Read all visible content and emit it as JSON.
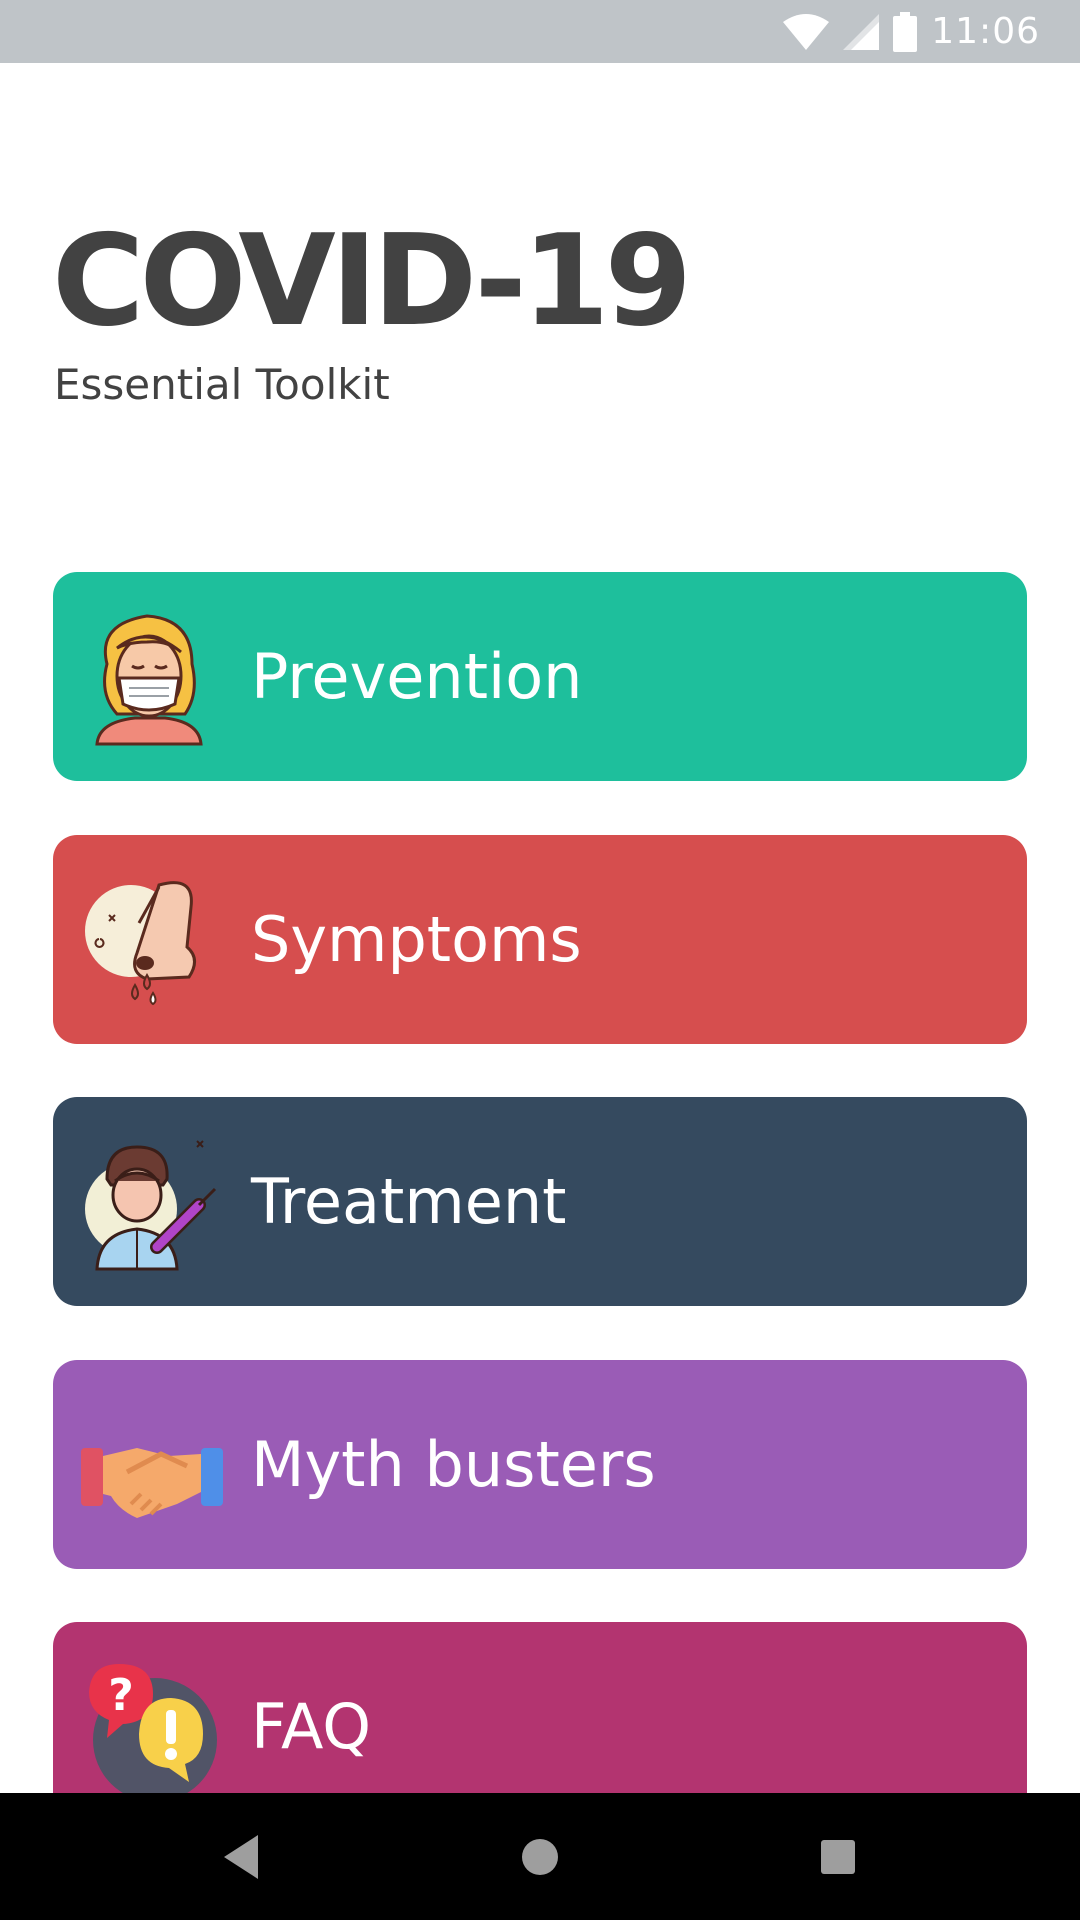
{
  "status_bar": {
    "time": "11:06",
    "icons": [
      "wifi-icon",
      "cell-signal-icon",
      "battery-icon"
    ]
  },
  "header": {
    "title": "COVID-19",
    "subtitle": "Essential Toolkit"
  },
  "menu": {
    "items": [
      {
        "label": "Prevention",
        "color": "#1ebf9c",
        "icon": "masked-woman-icon"
      },
      {
        "label": "Symptoms",
        "color": "#d64e4e",
        "icon": "runny-nose-icon"
      },
      {
        "label": "Treatment",
        "color": "#354a5f",
        "icon": "doctor-syringe-icon"
      },
      {
        "label": "Myth busters",
        "color": "#9a5cb6",
        "icon": "handshake-icon"
      },
      {
        "label": "FAQ",
        "color": "#b33470",
        "icon": "question-exclamation-icon"
      }
    ]
  },
  "nav_bar": {
    "buttons": [
      "back-icon",
      "home-icon",
      "recents-icon"
    ]
  }
}
